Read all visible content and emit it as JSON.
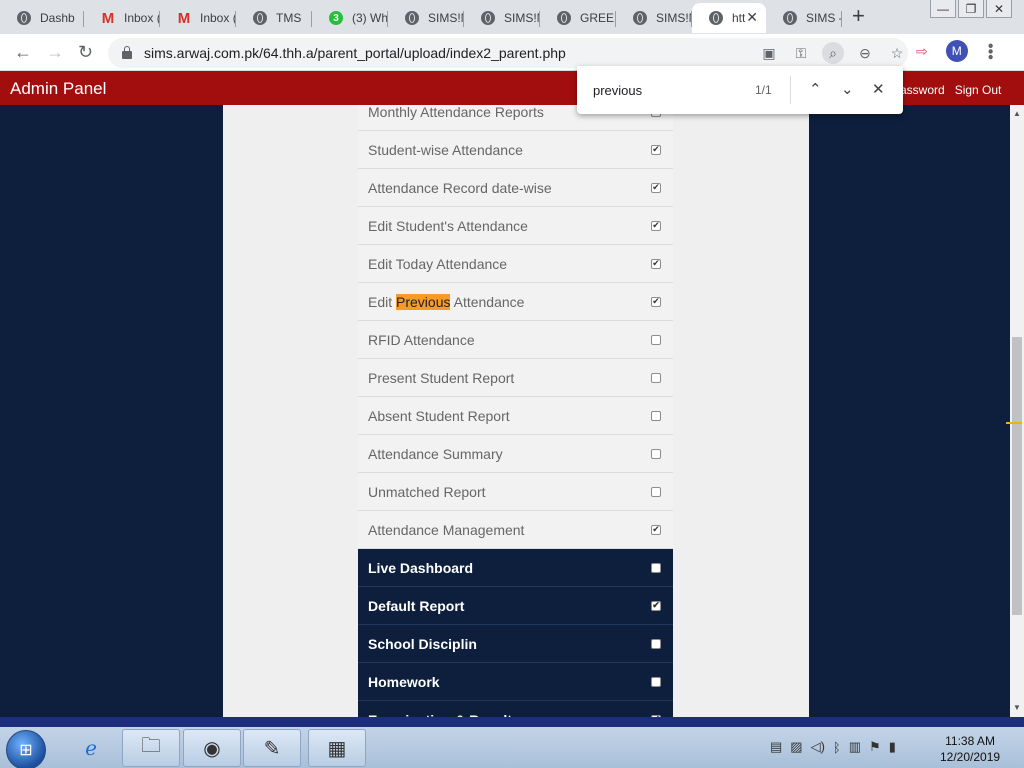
{
  "browser": {
    "tabs": [
      {
        "title": "Dashb",
        "icon": "globe-icon"
      },
      {
        "title": "Inbox (",
        "icon": "gmail-icon"
      },
      {
        "title": "Inbox (",
        "icon": "gmail-icon"
      },
      {
        "title": "TMS",
        "icon": "globe-icon"
      },
      {
        "title": "(3) Wh",
        "icon": "whatsapp-icon",
        "badge": "3"
      },
      {
        "title": "SIMS!N",
        "icon": "globe-icon"
      },
      {
        "title": "SIMS!N",
        "icon": "globe-icon"
      },
      {
        "title": "GREEN",
        "icon": "globe-icon"
      },
      {
        "title": "SIMS!N",
        "icon": "globe-icon"
      },
      {
        "title": "htt",
        "icon": "globe-icon",
        "active": true
      },
      {
        "title": "SIMS -",
        "icon": "globe-icon"
      }
    ],
    "url": "sims.arwaj.com.pk/64.thh.a/parent_portal/upload/index2_parent.php",
    "avatar_letter": "M"
  },
  "find": {
    "query": "previous",
    "count": "1/1"
  },
  "header": {
    "title": "Admin Panel",
    "change_password": "assword",
    "sign_out": "Sign Out"
  },
  "permissions": {
    "rows": [
      {
        "label": "Monthly Attendance Reports",
        "checked": false,
        "dark": false
      },
      {
        "label": "Student-wise Attendance",
        "checked": true,
        "dark": false
      },
      {
        "label": "Attendance Record date-wise",
        "checked": true,
        "dark": false
      },
      {
        "label": "Edit Student's Attendance",
        "checked": true,
        "dark": false
      },
      {
        "label": "Edit Today Attendance",
        "checked": true,
        "dark": false
      },
      {
        "label_pre": "Edit ",
        "label_hl": "Previous",
        "label_post": " Attendance",
        "checked": true,
        "dark": false
      },
      {
        "label": "RFID Attendance",
        "checked": false,
        "dark": false
      },
      {
        "label": "Present Student Report",
        "checked": false,
        "dark": false
      },
      {
        "label": "Absent Student Report",
        "checked": false,
        "dark": false
      },
      {
        "label": "Attendance Summary",
        "checked": false,
        "dark": false
      },
      {
        "label": "Unmatched Report",
        "checked": false,
        "dark": false
      },
      {
        "label": "Attendance Management",
        "checked": true,
        "dark": false
      },
      {
        "label": "Live Dashboard",
        "checked": false,
        "dark": true
      },
      {
        "label": "Default Report",
        "checked": true,
        "dark": true
      },
      {
        "label": "School Disciplin",
        "checked": false,
        "dark": true
      },
      {
        "label": "Homework",
        "checked": false,
        "dark": true
      },
      {
        "label": "Examination & Result",
        "checked": true,
        "dark": true
      }
    ]
  },
  "taskbar": {
    "time": "11:38 AM",
    "date": "12/20/2019"
  }
}
